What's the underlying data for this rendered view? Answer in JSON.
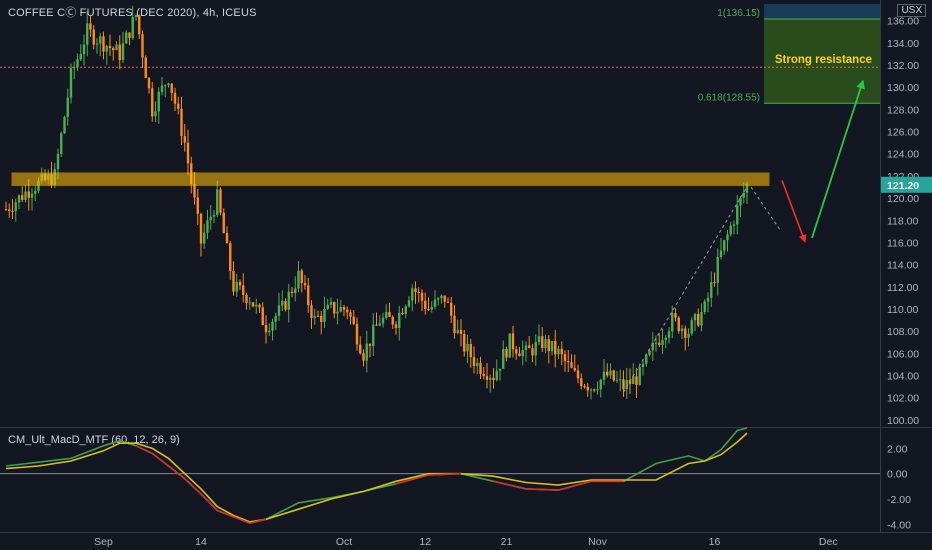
{
  "header": {
    "title": "COFFEE CⒸ FUTURES (DEC 2020), 4h, ICEUS",
    "currency": "USX"
  },
  "indicator": {
    "title": "CM_Ult_MacD_MTF (60, 12, 26, 9)"
  },
  "colors": {
    "background": "#131722",
    "bull": "#4caf50",
    "bear": "#ff8c1a",
    "resistance_line": "#ff5a4f",
    "resistance_band": "#ffc107",
    "macd": "#43a047",
    "signal": "#d8c11b",
    "arrow_down": "#ff2a2a",
    "arrow_up": "#27c93f",
    "fib_box": "#1a4a6e",
    "fib_box2": "#2e5a1c"
  },
  "chart_data": [
    {
      "type": "candlestick",
      "ylim": [
        99,
        137.5
      ],
      "yticks": [
        "100.00",
        "102.00",
        "104.00",
        "106.00",
        "108.00",
        "110.00",
        "112.00",
        "114.00",
        "116.00",
        "118.00",
        "120.00",
        "122.00",
        "124.00",
        "126.00",
        "128.00",
        "130.00",
        "132.00",
        "134.00",
        "136.00",
        "138.00"
      ],
      "xticks": [
        "Sep",
        "14",
        "Oct",
        "12",
        "21",
        "Nov",
        "16",
        "Dec"
      ],
      "last_price": "121.20",
      "annotations": {
        "resistance_text": "Strong resistance",
        "resistance_level": 131.8,
        "zone": [
          121.4,
          122.0
        ],
        "fib_1": "1(136.15)",
        "fib_1_level": 136.15,
        "fib_0618": "0.618(128.55)",
        "fib_0618_level": 128.55
      },
      "path": [
        [
          0,
          119
        ],
        [
          8,
          121
        ],
        [
          15,
          122
        ],
        [
          20,
          131
        ],
        [
          25,
          135
        ],
        [
          30,
          134
        ],
        [
          35,
          133
        ],
        [
          40,
          136.5
        ],
        [
          45,
          128
        ],
        [
          50,
          131
        ],
        [
          55,
          125
        ],
        [
          60,
          116
        ],
        [
          65,
          120
        ],
        [
          70,
          112
        ],
        [
          75,
          111
        ],
        [
          80,
          108.5
        ],
        [
          85,
          110
        ],
        [
          90,
          113
        ],
        [
          95,
          109
        ],
        [
          100,
          110
        ],
        [
          105,
          110
        ],
        [
          110,
          106
        ],
        [
          115,
          109
        ],
        [
          120,
          109
        ],
        [
          125,
          112
        ],
        [
          130,
          110
        ],
        [
          135,
          111
        ],
        [
          140,
          107
        ],
        [
          145,
          105
        ],
        [
          150,
          104
        ],
        [
          155,
          107
        ],
        [
          160,
          106
        ],
        [
          165,
          107
        ],
        [
          170,
          106
        ],
        [
          175,
          104
        ],
        [
          180,
          103
        ],
        [
          185,
          104
        ],
        [
          190,
          103
        ],
        [
          195,
          104
        ],
        [
          200,
          107
        ],
        [
          205,
          109
        ],
        [
          210,
          108
        ],
        [
          215,
          110
        ],
        [
          220,
          115
        ],
        [
          225,
          119
        ],
        [
          228,
          121.2
        ]
      ]
    },
    {
      "type": "line",
      "title": "CM_Ult_MacD_MTF (60, 12, 26, 9)",
      "ylim": [
        -4.6,
        3.6
      ],
      "yticks": [
        "2.00",
        "0.00",
        "-2.00",
        "-4.00"
      ],
      "series": [
        {
          "x": [
            0,
            10,
            20,
            30,
            35,
            40,
            45,
            50,
            55,
            60,
            65,
            70,
            75,
            80,
            90,
            100,
            110,
            120,
            130,
            140,
            150,
            160,
            170,
            180,
            190,
            200,
            210,
            215,
            220,
            225,
            228
          ],
          "values": [
            0.6,
            0.9,
            1.2,
            2.2,
            2.6,
            2.2,
            1.6,
            0.6,
            -0.4,
            -1.6,
            -2.9,
            -3.4,
            -3.9,
            -3.6,
            -2.3,
            -1.9,
            -1.4,
            -0.8,
            -0.1,
            0.0,
            -0.6,
            -1.2,
            -1.3,
            -0.6,
            -0.6,
            0.8,
            1.4,
            1.0,
            1.9,
            3.4,
            3.6
          ]
        },
        {
          "x": [
            0,
            10,
            20,
            30,
            35,
            40,
            45,
            50,
            55,
            60,
            65,
            70,
            75,
            80,
            90,
            100,
            110,
            120,
            130,
            140,
            150,
            160,
            170,
            180,
            190,
            200,
            210,
            215,
            220,
            225,
            228
          ],
          "values": [
            0.4,
            0.6,
            1.0,
            1.8,
            2.4,
            2.4,
            2.0,
            1.2,
            0.0,
            -1.2,
            -2.6,
            -3.3,
            -3.8,
            -3.6,
            -2.8,
            -2.0,
            -1.4,
            -0.6,
            0.0,
            0.0,
            -0.2,
            -0.7,
            -0.9,
            -0.5,
            -0.5,
            -0.5,
            0.8,
            1.0,
            1.5,
            2.5,
            3.2
          ]
        }
      ]
    }
  ]
}
